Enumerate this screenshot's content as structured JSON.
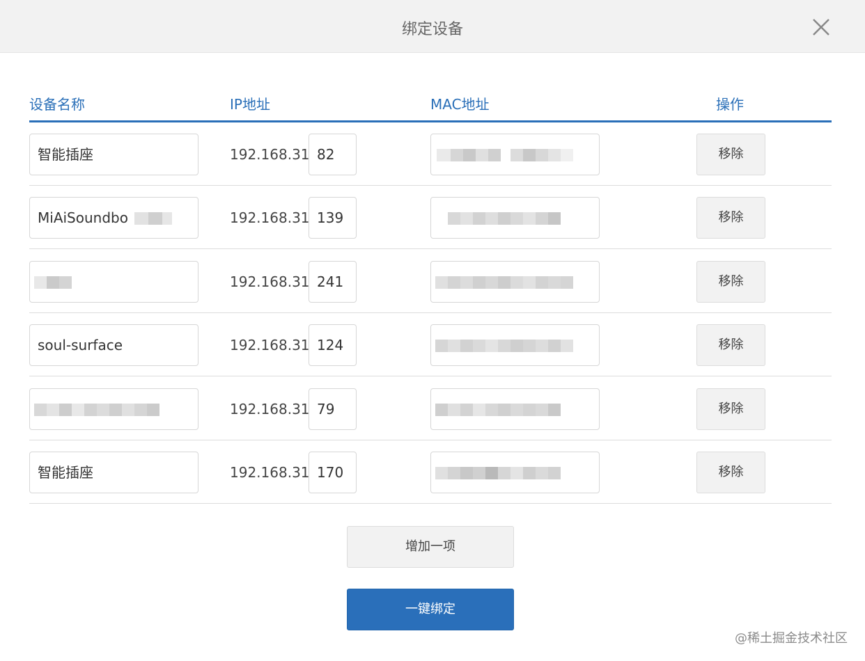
{
  "dialog": {
    "title": "绑定设备",
    "close_icon": "close-icon"
  },
  "table": {
    "headers": {
      "name": "设备名称",
      "ip": "IP地址",
      "mac": "MAC地址",
      "action": "操作"
    },
    "rows": [
      {
        "name": "智能插座",
        "ip_prefix": "192.168.31.",
        "ip_last": "82",
        "mac": "",
        "remove": "移除"
      },
      {
        "name": "MiAiSoundbo",
        "ip_prefix": "192.168.31.",
        "ip_last": "139",
        "mac": "",
        "remove": "移除"
      },
      {
        "name": "",
        "ip_prefix": "192.168.31.",
        "ip_last": "241",
        "mac": "",
        "remove": "移除"
      },
      {
        "name": "soul-surface",
        "ip_prefix": "192.168.31.",
        "ip_last": "124",
        "mac": "",
        "remove": "移除"
      },
      {
        "name": "",
        "ip_prefix": "192.168.31.",
        "ip_last": "79",
        "mac": "",
        "remove": "移除"
      },
      {
        "name": "智能插座",
        "ip_prefix": "192.168.31.",
        "ip_last": "170",
        "mac": "",
        "remove": "移除"
      }
    ]
  },
  "actions": {
    "add_label": "增加一项",
    "bind_label": "一键绑定"
  },
  "watermark": "@稀土掘金技术社区",
  "colors": {
    "accent": "#2a6fb8",
    "header_bg": "#f2f2f2",
    "primary_button": "#2a6fba"
  }
}
